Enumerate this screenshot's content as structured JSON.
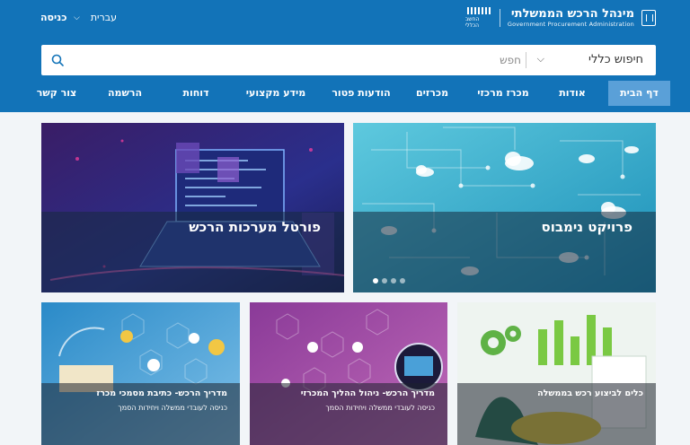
{
  "header": {
    "logo_title": "מינהל הרכש הממשלתי",
    "logo_subtitle": "Government Procurement Administration",
    "logo_mark_text": "החשב הכללי",
    "login_label": "כניסה",
    "language_label": "עברית"
  },
  "search": {
    "scope_label": "חיפוש כללי",
    "placeholder": "חפש"
  },
  "nav": {
    "items": [
      {
        "label": "דף הבית"
      },
      {
        "label": "אודות"
      },
      {
        "label": "מכרז מרכזי"
      },
      {
        "label": "מכרזים"
      },
      {
        "label": "הודעות פטור"
      },
      {
        "label": "מידע מקצועי"
      },
      {
        "label": "דוחות"
      },
      {
        "label": "הרשמה"
      },
      {
        "label": "צור קשר"
      }
    ]
  },
  "cards": {
    "project": {
      "title": "פרויקט נימבוס"
    },
    "portal": {
      "title": "פורטל מערכות הרכש"
    },
    "tools": {
      "title": "כלים לביצוע רכש בממשלה"
    },
    "guide_process": {
      "title": "מדריך הרכש- ניהול ההליך המכרזי",
      "subtitle": "כניסה לעובדי ממשלה ויחידות הסמך"
    },
    "guide_docs": {
      "title": "מדריך הרכש- כתיבת מסמכי מכרז",
      "subtitle": "כניסה לעובדי ממשלה ויחידות הסמך"
    }
  },
  "colors": {
    "header_blue": "#1273b8",
    "active_nav": "#5aa0d8"
  }
}
